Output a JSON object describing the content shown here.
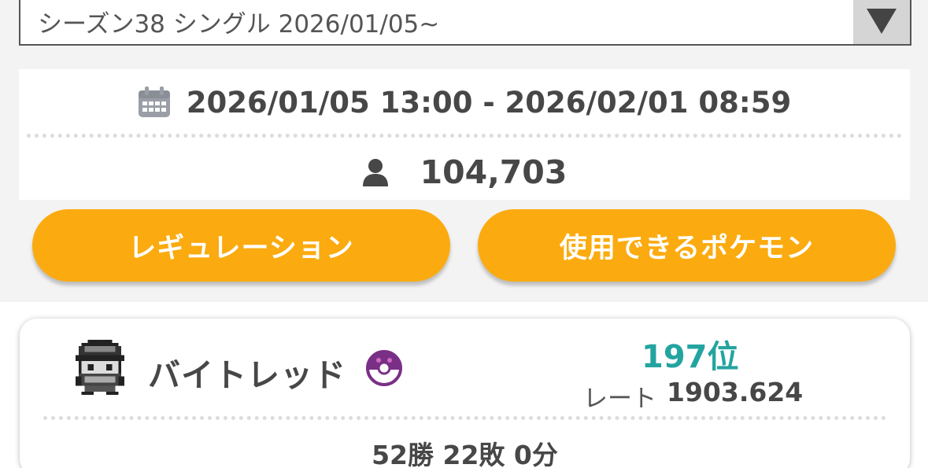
{
  "season_selector": {
    "selected": "シーズン38 シングル 2026/01/05~",
    "arrow_icon": "triangle-down-icon"
  },
  "season_info": {
    "period_icon": "calendar-icon",
    "period": "2026/01/05 13:00 - 2026/02/01 08:59",
    "players_icon": "person-icon",
    "players": "104,703"
  },
  "buttons": {
    "regulation": "レギュレーション",
    "usable_pokemon": "使用できるポケモン"
  },
  "player": {
    "name": "バイトレッド",
    "badge_icon": "master-ball-icon",
    "rank": "197位",
    "rate_label": "レート",
    "rate": "1903.624",
    "record": "52勝 22敗 0分"
  },
  "colors": {
    "accent_button": "#fbab0f",
    "rank_teal": "#24a4a0",
    "ball_purple": "#7a2f86"
  }
}
